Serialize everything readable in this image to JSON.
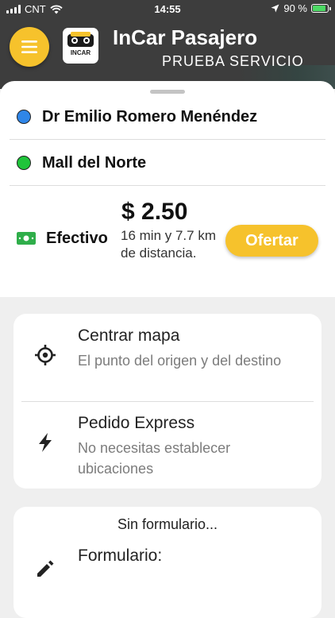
{
  "status_bar": {
    "carrier": "CNT",
    "time": "14:55",
    "battery": "90 %",
    "battery_level": 0.9,
    "icons": [
      "signal-icon",
      "wifi-icon",
      "location-arrow-icon",
      "battery-charging-icon"
    ]
  },
  "header": {
    "title": "InCar Pasajero",
    "subtitle": "PRUEBA SERVICIO",
    "logo_text": "INCAR",
    "menu_icon": "hamburger-menu-icon"
  },
  "trip": {
    "origin": "Dr Emilio Romero Menéndez",
    "destination": "Mall del Norte",
    "price": "$ 2.50",
    "payment_method": "Efectivo",
    "eta": "16 min y 7.7 km de distancia.",
    "offer_label": "Ofertar",
    "colors": {
      "origin_dot": "#2f86e8",
      "destination_dot": "#1fc43a",
      "accent": "#f6c22c",
      "cash": "#2fae4a"
    }
  },
  "options": [
    {
      "title": "Centrar mapa",
      "description": "El punto del origen y del destino",
      "icon": "crosshair-icon"
    },
    {
      "title": "Pedido Express",
      "description": "No necesitas establecer ubicaciones",
      "icon": "lightning-bolt-icon"
    }
  ],
  "form": {
    "no_form": "Sin formulario...",
    "label": "Formulario:",
    "icon": "pencil-icon"
  }
}
